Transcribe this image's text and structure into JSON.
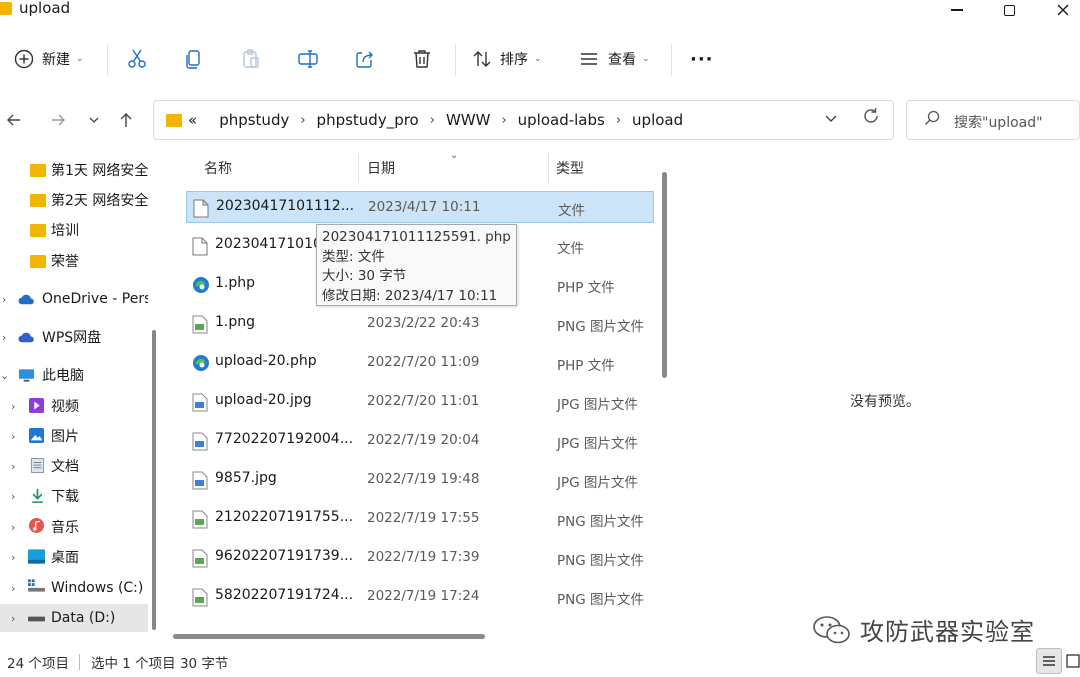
{
  "window": {
    "title": "upload"
  },
  "toolbar": {
    "new_label": "新建",
    "sort_label": "排序",
    "view_label": "查看",
    "more_label": "···"
  },
  "address": {
    "overflow": "«",
    "crumbs": [
      "phpstudy",
      "phpstudy_pro",
      "WWW",
      "upload-labs",
      "upload"
    ],
    "search_placeholder": "搜索\"upload\""
  },
  "sidebar": {
    "items": [
      {
        "label": "第1天 网络安全",
        "icon": "folder-icon"
      },
      {
        "label": "第2天 网络安全",
        "icon": "folder-icon"
      },
      {
        "label": "培训",
        "icon": "folder-icon"
      },
      {
        "label": "荣誉",
        "icon": "folder-icon"
      },
      {
        "label": "OneDrive - Pers",
        "icon": "cloud-icon"
      },
      {
        "label": "WPS网盘",
        "icon": "wps-cloud-icon"
      },
      {
        "label": "此电脑",
        "icon": "computer-icon"
      },
      {
        "label": "视频",
        "icon": "video-icon"
      },
      {
        "label": "图片",
        "icon": "picture-icon"
      },
      {
        "label": "文档",
        "icon": "document-icon"
      },
      {
        "label": "下载",
        "icon": "download-icon"
      },
      {
        "label": "音乐",
        "icon": "music-icon"
      },
      {
        "label": "桌面",
        "icon": "desktop-icon"
      },
      {
        "label": "Windows (C:)",
        "icon": "drive-c-icon"
      },
      {
        "label": "Data (D:)",
        "icon": "drive-d-icon"
      }
    ]
  },
  "columns": {
    "name": "名称",
    "date": "日期",
    "type": "类型"
  },
  "files": [
    {
      "name": "20230417101112...",
      "date": "2023/4/17 10:11",
      "type": "文件",
      "icon": "blank-file-icon",
      "selected": true
    },
    {
      "name": "202304171010",
      "date": "",
      "type": "文件",
      "icon": "blank-file-icon",
      "selected": false
    },
    {
      "name": "1.php",
      "date": "",
      "type": "PHP 文件",
      "icon": "edge-icon",
      "selected": false
    },
    {
      "name": "1.png",
      "date": "2023/2/22 20:43",
      "type": "PNG 图片文件",
      "icon": "png-file-icon",
      "selected": false
    },
    {
      "name": "upload-20.php",
      "date": "2022/7/20 11:09",
      "type": "PHP 文件",
      "icon": "edge-icon",
      "selected": false
    },
    {
      "name": "upload-20.jpg",
      "date": "2022/7/20 11:01",
      "type": "JPG 图片文件",
      "icon": "jpg-file-icon",
      "selected": false
    },
    {
      "name": "77202207192004...",
      "date": "2022/7/19 20:04",
      "type": "JPG 图片文件",
      "icon": "jpg-file-icon",
      "selected": false
    },
    {
      "name": "9857.jpg",
      "date": "2022/7/19 19:48",
      "type": "JPG 图片文件",
      "icon": "jpg-file-icon",
      "selected": false
    },
    {
      "name": "21202207191755...",
      "date": "2022/7/19 17:55",
      "type": "PNG 图片文件",
      "icon": "png-file-icon",
      "selected": false
    },
    {
      "name": "96202207191739...",
      "date": "2022/7/19 17:39",
      "type": "PNG 图片文件",
      "icon": "png-file-icon",
      "selected": false
    },
    {
      "name": "58202207191724...",
      "date": "2022/7/19 17:24",
      "type": "PNG 图片文件",
      "icon": "png-file-icon",
      "selected": false
    }
  ],
  "tooltip": {
    "line1": "20230417101112559​1. php",
    "line2": "类型: 文件",
    "line3": "大小: 30 字节",
    "line4": "修改日期: 2023/4/17 10:11"
  },
  "preview": {
    "empty_text": "没有预览。"
  },
  "status": {
    "item_count": "24 个项目",
    "selection": "选中 1 个项目  30 字节"
  },
  "watermark": {
    "text": "攻防武器实验室"
  },
  "colors": {
    "folder": "#f2b600",
    "selection_bg": "#cce4f7",
    "selection_border": "#99c9ef",
    "edge_blue": "#1f7ad8",
    "edge_green": "#4fc24f"
  }
}
